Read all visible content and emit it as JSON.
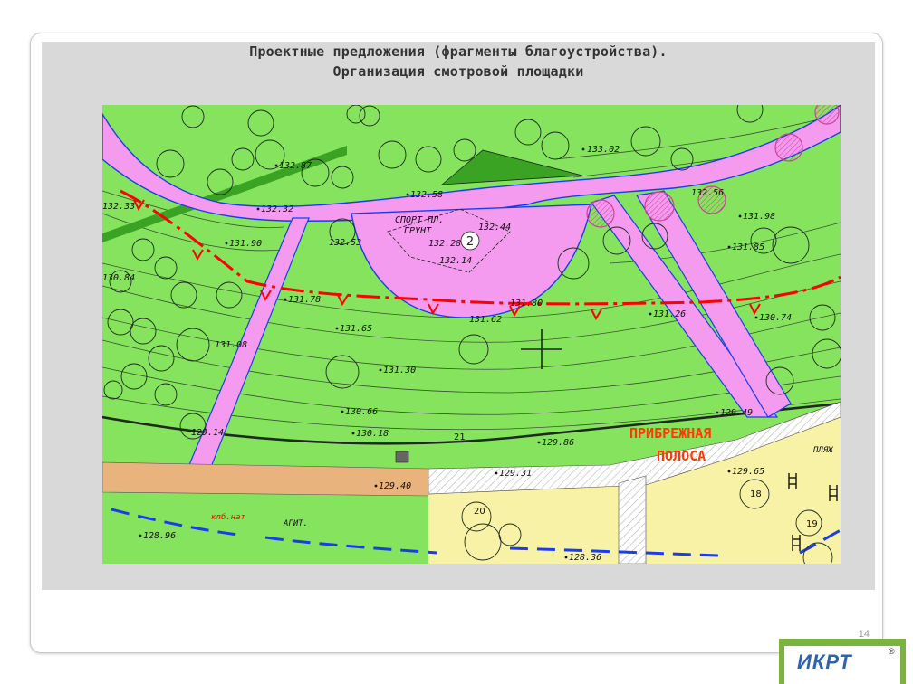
{
  "slide": {
    "title_line1": "Проектные предложения (фрагменты благоустройства).",
    "title_line2": "Организация смотровой площадки",
    "page_number": "14"
  },
  "map": {
    "sport_label_line1": "СПОРТ ПЛ.",
    "sport_label_line2": "ГРУНТ",
    "site_number": "2",
    "shore_label_line1": "ПРИБРЕЖНАЯ",
    "shore_label_line2": "ПОЛОСА",
    "beach_label": "ПЛЯЖ",
    "club_label": "клб.нат",
    "agit_label": "АГИТ.",
    "plot_numbers": [
      "21",
      "20",
      "19",
      "18"
    ],
    "elevations": [
      {
        "label": "133.02"
      },
      {
        "label": "132.87"
      },
      {
        "label": "132.58"
      },
      {
        "label": "132.32"
      },
      {
        "label": "132.53"
      },
      {
        "label": "132.44"
      },
      {
        "label": "132.28"
      },
      {
        "label": "132.14"
      },
      {
        "label": "132.56"
      },
      {
        "label": "131.98"
      },
      {
        "label": "131.90"
      },
      {
        "label": "131.85"
      },
      {
        "label": "131.78"
      },
      {
        "label": "131.80"
      },
      {
        "label": "131.62"
      },
      {
        "label": "131.26"
      },
      {
        "label": "130.74"
      },
      {
        "label": "131.65"
      },
      {
        "label": "131.08"
      },
      {
        "label": "131.30"
      },
      {
        "label": "130.66"
      },
      {
        "label": "129.49"
      },
      {
        "label": "130.18"
      },
      {
        "label": "129.14"
      },
      {
        "label": "129.86"
      },
      {
        "label": "129.31"
      },
      {
        "label": "129.40"
      },
      {
        "label": "129.65"
      },
      {
        "label": "128.96"
      },
      {
        "label": "128.36"
      },
      {
        "label": "132.33"
      },
      {
        "label": "130.84"
      }
    ]
  },
  "logo": {
    "text": "ИКРТ",
    "registered": "®"
  },
  "colors": {
    "grass": "#86e35d",
    "path_pink": "#f49bef",
    "sand": "#f7f2a6",
    "orange_strip": "#e9b37e",
    "dark_green": "#3aa324",
    "red_line": "#ff0000",
    "blue_line": "#1a3cf0"
  }
}
